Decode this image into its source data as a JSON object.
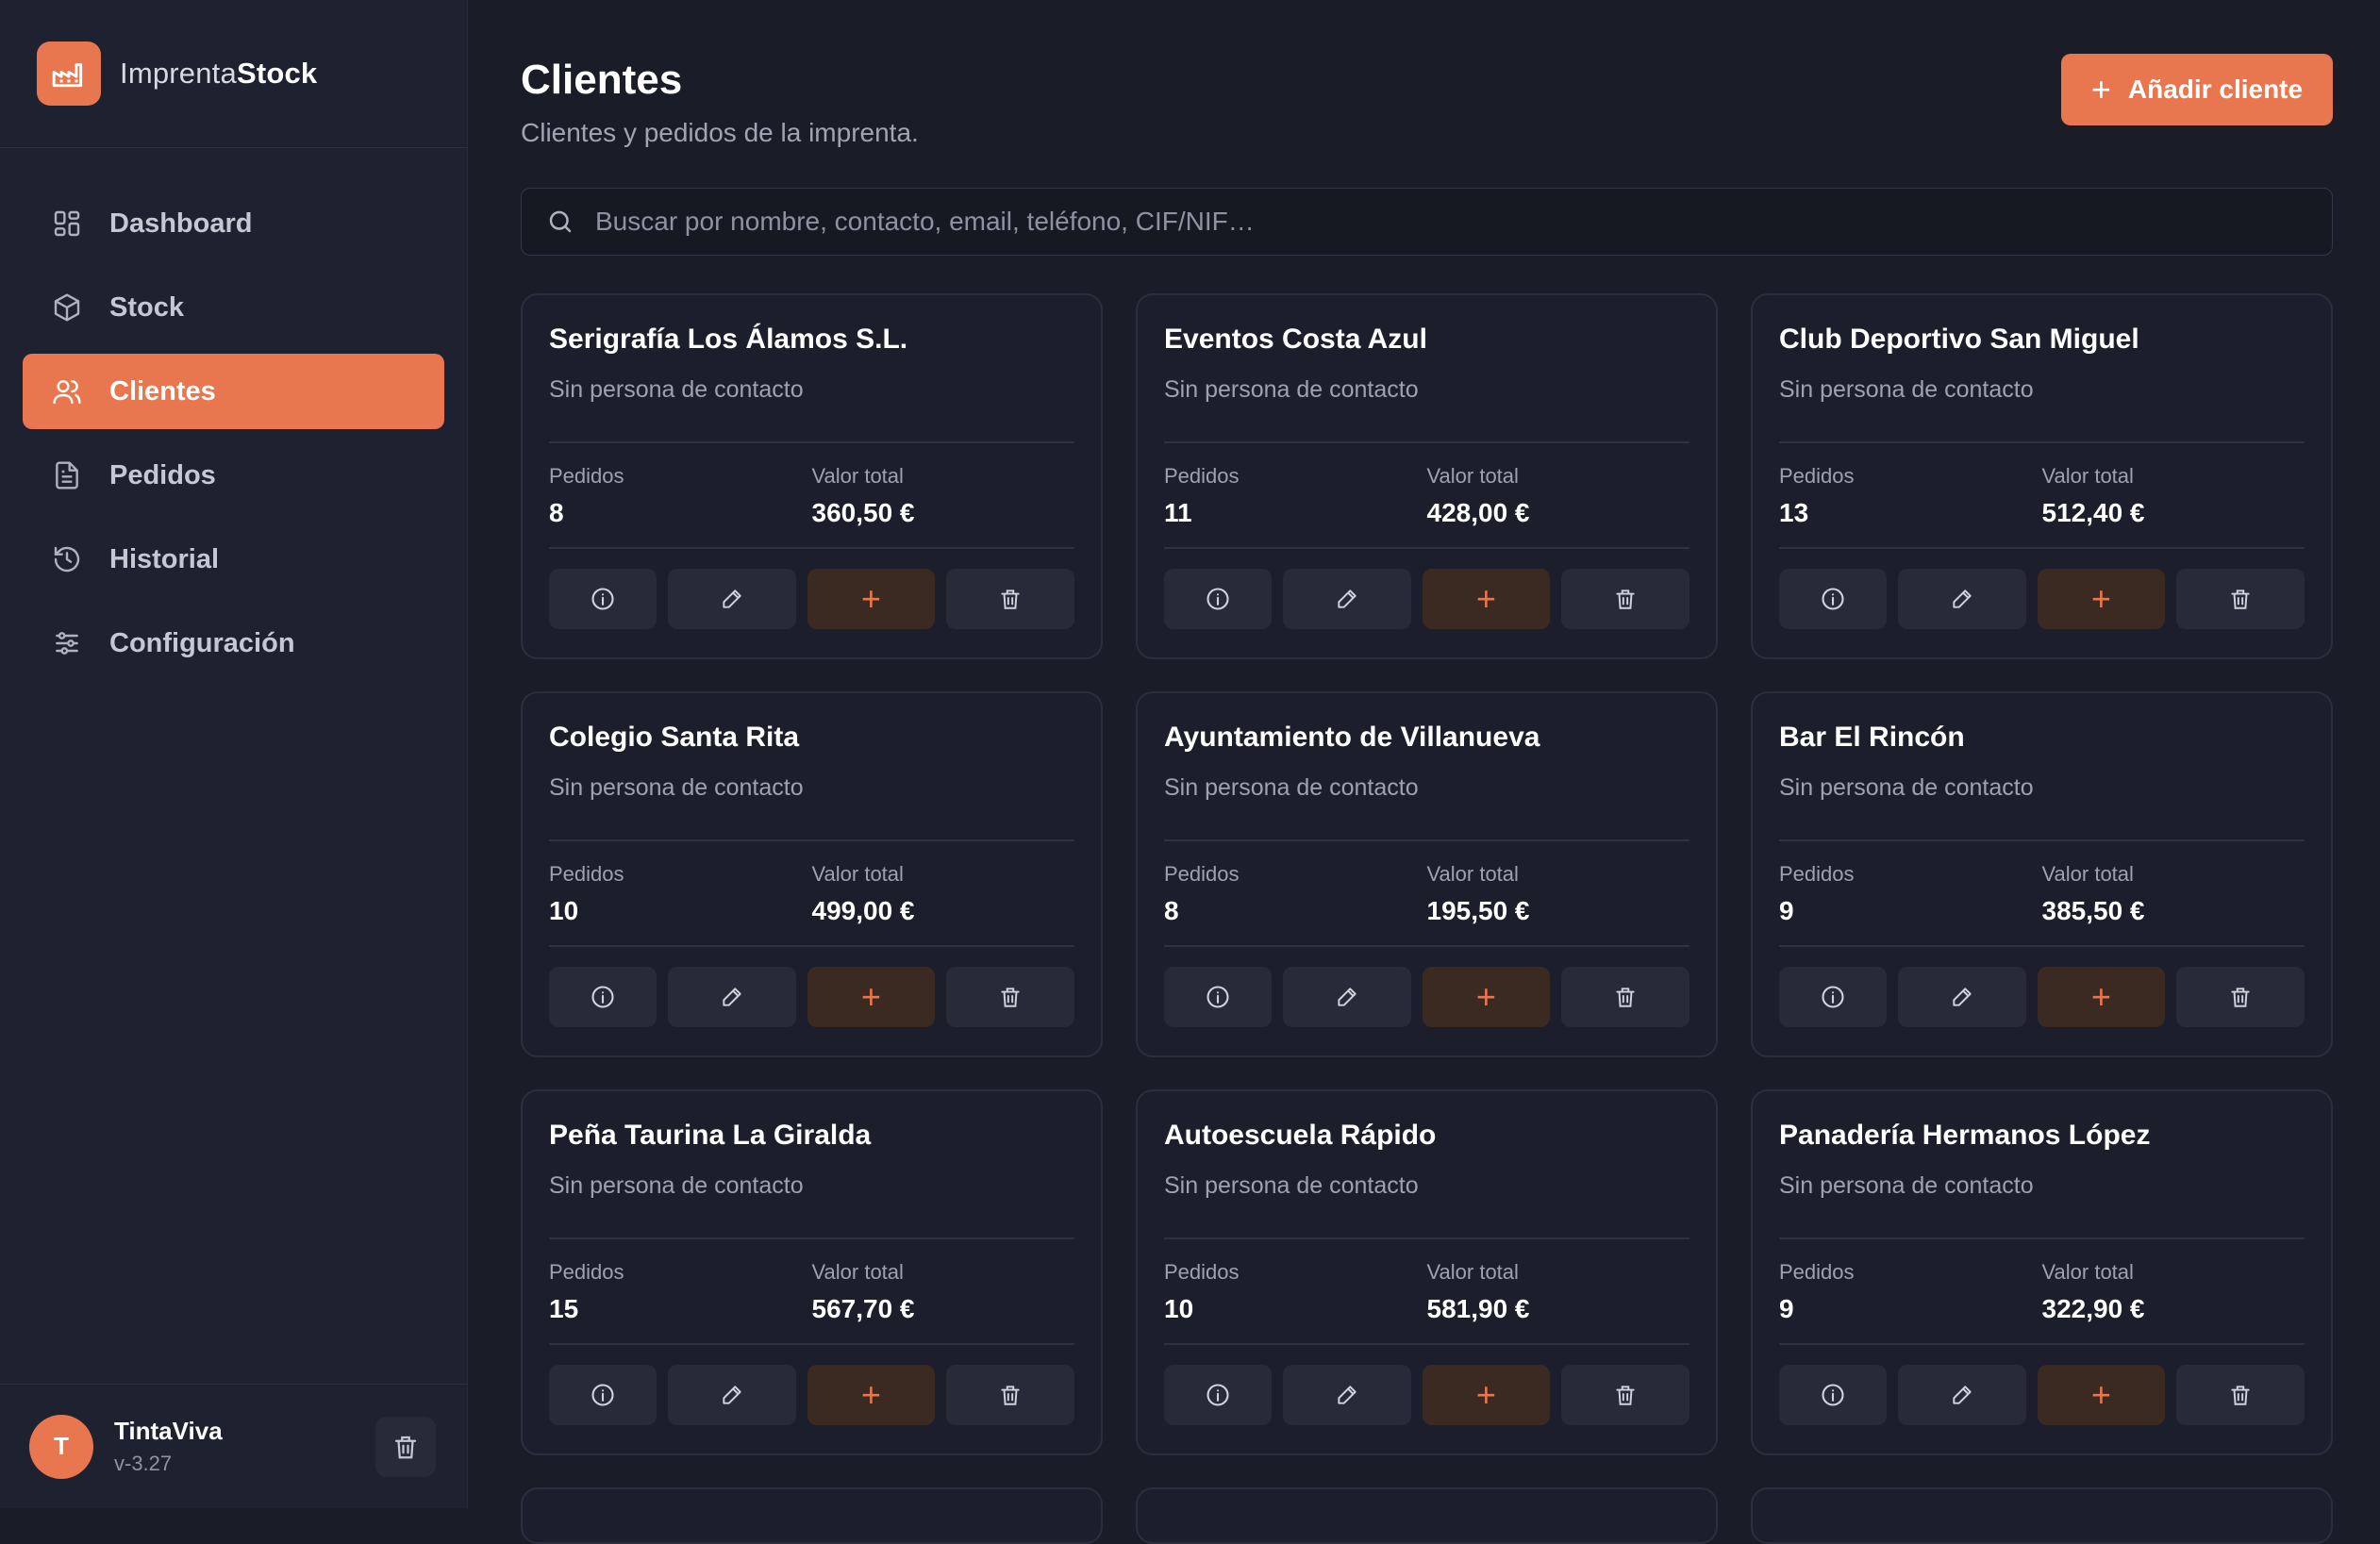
{
  "brand": {
    "name_light": "Imprenta",
    "name_bold": "Stock",
    "logo_icon": "factory-icon"
  },
  "nav": [
    {
      "label": "Dashboard",
      "icon": "dashboard-icon",
      "active": false
    },
    {
      "label": "Stock",
      "icon": "box-icon",
      "active": false
    },
    {
      "label": "Clientes",
      "icon": "users-icon",
      "active": true
    },
    {
      "label": "Pedidos",
      "icon": "document-icon",
      "active": false
    },
    {
      "label": "Historial",
      "icon": "history-icon",
      "active": false
    },
    {
      "label": "Configuración",
      "icon": "sliders-icon",
      "active": false
    }
  ],
  "user": {
    "initial": "T",
    "name": "TintaViva",
    "version": "v-3.27"
  },
  "header": {
    "title": "Clientes",
    "subtitle": "Clientes y pedidos de la imprenta.",
    "add_label": "Añadir cliente"
  },
  "search": {
    "placeholder": "Buscar por nombre, contacto, email, teléfono, CIF/NIF…",
    "value": ""
  },
  "labels": {
    "orders": "Pedidos",
    "total": "Valor total"
  },
  "clients": [
    {
      "name": "Serigrafía Los Álamos S.L.",
      "contact": "Sin persona de contacto",
      "orders": "8",
      "total": "360,50 €"
    },
    {
      "name": "Eventos Costa Azul",
      "contact": "Sin persona de contacto",
      "orders": "11",
      "total": "428,00 €"
    },
    {
      "name": "Club Deportivo San Miguel",
      "contact": "Sin persona de contacto",
      "orders": "13",
      "total": "512,40 €"
    },
    {
      "name": "Colegio Santa Rita",
      "contact": "Sin persona de contacto",
      "orders": "10",
      "total": "499,00 €"
    },
    {
      "name": "Ayuntamiento de Villanueva",
      "contact": "Sin persona de contacto",
      "orders": "8",
      "total": "195,50 €"
    },
    {
      "name": "Bar El Rincón",
      "contact": "Sin persona de contacto",
      "orders": "9",
      "total": "385,50 €"
    },
    {
      "name": "Peña Taurina La Giralda",
      "contact": "Sin persona de contacto",
      "orders": "15",
      "total": "567,70 €"
    },
    {
      "name": "Autoescuela Rápido",
      "contact": "Sin persona de contacto",
      "orders": "10",
      "total": "581,90 €"
    },
    {
      "name": "Panadería Hermanos López",
      "contact": "Sin persona de contacto",
      "orders": "9",
      "total": "322,90 €"
    }
  ],
  "colors": {
    "accent": "#e8774f",
    "background": "#1a1d27",
    "sidebar": "#1e2130",
    "card": "#1c1f2b"
  }
}
